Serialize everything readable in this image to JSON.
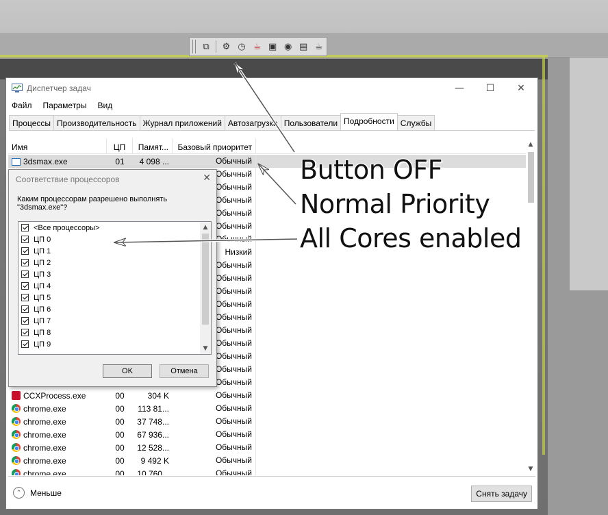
{
  "toolbar": {
    "icons": [
      "copy-doc-icon",
      "settings-gear-icon",
      "clock-bolt-icon",
      "teapot-render-icon",
      "frame-window-icon",
      "eye-refresh-icon",
      "clipboard-icon",
      "teapot-outline-icon"
    ]
  },
  "window": {
    "title": "Диспетчер задач",
    "controls": {
      "minimize": "—",
      "maximize": "☐",
      "close": "✕"
    }
  },
  "menu": {
    "items": [
      "Файл",
      "Параметры",
      "Вид"
    ]
  },
  "tabs": [
    {
      "label": "Процессы",
      "active": false
    },
    {
      "label": "Производительность",
      "active": false
    },
    {
      "label": "Журнал приложений",
      "active": false
    },
    {
      "label": "Автозагрузка",
      "active": false
    },
    {
      "label": "Пользователи",
      "active": false
    },
    {
      "label": "Подробности",
      "active": true
    },
    {
      "label": "Службы",
      "active": false
    }
  ],
  "table": {
    "columns": {
      "name": "Имя",
      "cpu": "ЦП",
      "mem": "Памят...",
      "priority": "Базовый приоритет"
    },
    "rows": [
      {
        "name": "3dsmax.exe",
        "cpu": "01",
        "mem": "4 098 ...",
        "priority": "Обычный",
        "icon": "window-icon",
        "selected": true
      },
      {
        "name": "",
        "cpu": "",
        "mem": "",
        "priority": "Обычный"
      },
      {
        "name": "",
        "cpu": "",
        "mem": "",
        "priority": "Обычный"
      },
      {
        "name": "",
        "cpu": "",
        "mem": "",
        "priority": "Обычный"
      },
      {
        "name": "",
        "cpu": "",
        "mem": "",
        "priority": "Обычный"
      },
      {
        "name": "",
        "cpu": "",
        "mem": "",
        "priority": "Обычный"
      },
      {
        "name": "",
        "cpu": "",
        "mem": "",
        "priority": "Обычный"
      },
      {
        "name": "",
        "cpu": "",
        "mem": "",
        "priority": "Низкий"
      },
      {
        "name": "",
        "cpu": "",
        "mem": "",
        "priority": "Обычный"
      },
      {
        "name": "",
        "cpu": "",
        "mem": "",
        "priority": "Обычный"
      },
      {
        "name": "",
        "cpu": "",
        "mem": "",
        "priority": "Обычный"
      },
      {
        "name": "",
        "cpu": "",
        "mem": "",
        "priority": "Обычный"
      },
      {
        "name": "",
        "cpu": "",
        "mem": "",
        "priority": "Обычный"
      },
      {
        "name": "",
        "cpu": "",
        "mem": "",
        "priority": "Обычный"
      },
      {
        "name": "",
        "cpu": "",
        "mem": "",
        "priority": "Обычный"
      },
      {
        "name": "",
        "cpu": "",
        "mem": "",
        "priority": "Обычный"
      },
      {
        "name": "",
        "cpu": "",
        "mem": "",
        "priority": "Обычный"
      },
      {
        "name": "",
        "cpu": "",
        "mem": "",
        "priority": "Обычный"
      },
      {
        "name": "CCXProcess.exe",
        "cpu": "00",
        "mem": "304 K",
        "priority": "Обычный",
        "icon": "adobe-cc-icon"
      },
      {
        "name": "chrome.exe",
        "cpu": "00",
        "mem": "113 81...",
        "priority": "Обычный",
        "icon": "chrome-icon"
      },
      {
        "name": "chrome.exe",
        "cpu": "00",
        "mem": "37 748...",
        "priority": "Обычный",
        "icon": "chrome-icon"
      },
      {
        "name": "chrome.exe",
        "cpu": "00",
        "mem": "67 936...",
        "priority": "Обычный",
        "icon": "chrome-icon"
      },
      {
        "name": "chrome.exe",
        "cpu": "00",
        "mem": "12 528...",
        "priority": "Обычный",
        "icon": "chrome-icon"
      },
      {
        "name": "chrome.exe",
        "cpu": "00",
        "mem": "9 492 K",
        "priority": "Обычный",
        "icon": "chrome-icon"
      },
      {
        "name": "chrome.exe",
        "cpu": "00",
        "mem": "10 760...",
        "priority": "Обычный",
        "icon": "chrome-icon"
      }
    ]
  },
  "footer": {
    "less_label": "Меньше",
    "end_task_label": "Снять задачу"
  },
  "dialog": {
    "title": "Соответствие процессоров",
    "question": "Каким процессорам разрешено выполнять \"3dsmax.exe\"?",
    "items": [
      {
        "label": "<Все процессоры>",
        "checked": true
      },
      {
        "label": "ЦП 0",
        "checked": true
      },
      {
        "label": "ЦП 1",
        "checked": true
      },
      {
        "label": "ЦП 2",
        "checked": true
      },
      {
        "label": "ЦП 3",
        "checked": true
      },
      {
        "label": "ЦП 4",
        "checked": true
      },
      {
        "label": "ЦП 5",
        "checked": true
      },
      {
        "label": "ЦП 6",
        "checked": true
      },
      {
        "label": "ЦП 7",
        "checked": true
      },
      {
        "label": "ЦП 8",
        "checked": true
      },
      {
        "label": "ЦП 9",
        "checked": true
      }
    ],
    "ok_label": "OK",
    "cancel_label": "Отмена"
  },
  "annotations": [
    "Button OFF",
    "Normal Priority",
    "All Cores enabled"
  ]
}
